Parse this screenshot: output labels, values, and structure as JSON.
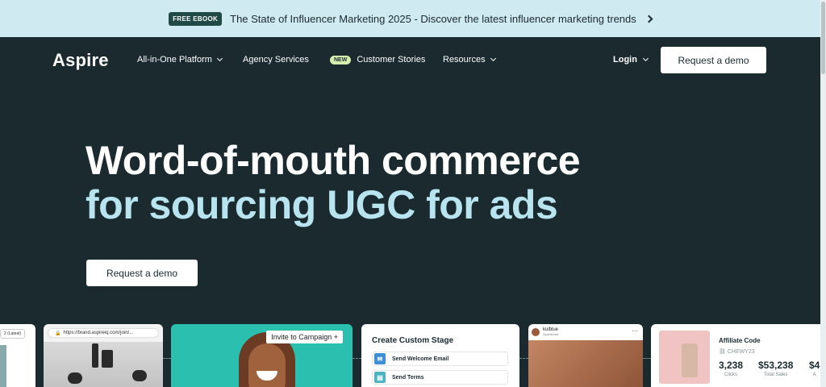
{
  "announcement": {
    "badge": "FREE EBOOK",
    "text": "The State of Influencer Marketing 2025 - Discover the latest influencer marketing trends"
  },
  "nav": {
    "logo": "Aspire",
    "items": [
      {
        "label": "All-in-One Platform",
        "dropdown": true
      },
      {
        "label": "Agency Services",
        "dropdown": false
      },
      {
        "label": "Customer Stories",
        "badge": "NEW",
        "dropdown": false
      },
      {
        "label": "Resources",
        "dropdown": true
      }
    ],
    "login": "Login",
    "cta": "Request a demo"
  },
  "hero": {
    "line1": "Word-of-mouth commerce",
    "line2": "for sourcing UGC for ads",
    "cta": "Request a demo"
  },
  "cards": {
    "card1": {
      "select": "2 (Latest)"
    },
    "card2": {
      "url": "https://brand.aspireiq.com/join/..."
    },
    "card3": {
      "button": "Invite to Campaign +"
    },
    "card4": {
      "title": "Create Custom Stage",
      "rows": [
        {
          "label": "Send Welcome Email",
          "icon": "mail-icon",
          "color": "#3d8fd6"
        },
        {
          "label": "Send Terms",
          "icon": "document-icon",
          "color": "#4bb3c1"
        }
      ]
    },
    "card5": {
      "name": "kulblue",
      "sub": "Sponsored",
      "menu": "···"
    },
    "card6": {
      "title": "Affiliate Code",
      "code": "CHEWY23",
      "stats": [
        {
          "value": "3,238",
          "label": "Clicks"
        },
        {
          "value": "$53,238",
          "label": "Total Sales"
        },
        {
          "value": "$4",
          "label": "A"
        }
      ]
    }
  },
  "colors": {
    "background": "#1a2a2f",
    "announce_bg": "#cfeaf1",
    "hero_accent": "#b7e4ee"
  }
}
